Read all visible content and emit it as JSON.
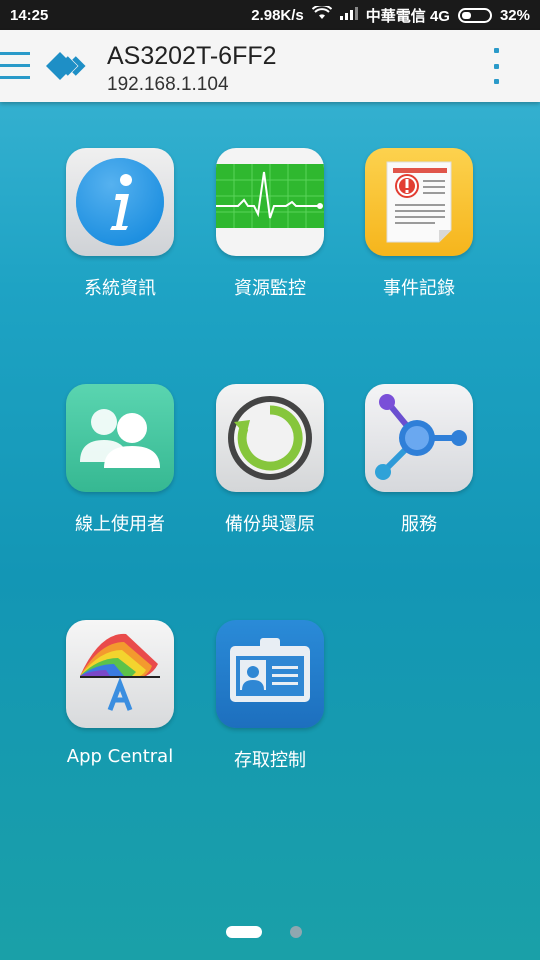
{
  "status_bar": {
    "time": "14:25",
    "speed": "2.98K/s",
    "carrier": "中華電信 4G",
    "battery": "32%"
  },
  "app_bar": {
    "title": "AS3202T-6FF2",
    "subtitle": "192.168.1.104"
  },
  "apps": [
    {
      "label": "系統資訊",
      "icon": "info-icon"
    },
    {
      "label": "資源監控",
      "icon": "heartbeat-monitor-icon"
    },
    {
      "label": "事件記錄",
      "icon": "event-log-icon"
    },
    {
      "label": "線上使用者",
      "icon": "online-users-icon"
    },
    {
      "label": "備份與還原",
      "icon": "backup-restore-icon"
    },
    {
      "label": "服務",
      "icon": "services-icon"
    },
    {
      "label": "App Central",
      "icon": "app-central-icon"
    },
    {
      "label": "存取控制",
      "icon": "access-control-icon"
    }
  ],
  "pager": {
    "pages": 2,
    "current": 1
  },
  "colors": {
    "accent": "#2a9ac9",
    "status_bar": "#1a1a1a",
    "app_bar": "#f5f5f5"
  }
}
